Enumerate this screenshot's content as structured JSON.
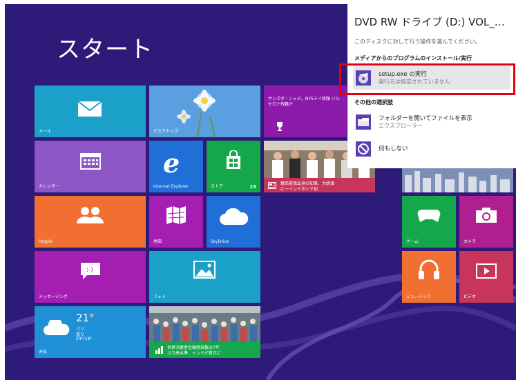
{
  "screen": {
    "title": "スタート"
  },
  "tiles": {
    "mail": "メール",
    "desktop": "デスクトップ",
    "news_headline": "サンズボ・シャピ。NY5テイ修顔 バルセロナ残籍か",
    "calendar": "カレンダー",
    "ie": "Internet Explorer",
    "store": "ストア",
    "store_badge": "15",
    "news2_line1": "爾西豪徳出身の知事、大統領",
    "news2_line2": "にーインドネシア初",
    "people": "People",
    "maps": "地図",
    "skydrive": "SkyDrive",
    "games": "ゲーム",
    "camera": "カメラ",
    "messaging": "メッセージング",
    "photos": "フォト",
    "music": "ミュージック",
    "video": "ビデオ",
    "weather_temp": "21°",
    "weather_city": "パリ",
    "weather_cond": "曇り",
    "weather_range": "24°/18°",
    "weather": "天気",
    "finance_line1": "世界消費者信頼感指数は7年",
    "finance_line2": "ぶり高水準、インドが首位に"
  },
  "popup": {
    "title": "DVD RW ドライブ (D:) VOL_…",
    "subtitle": "このディスクに対して行う操作を選んでください。",
    "section_install": "メディアからのプログラムのインストール/実行",
    "option_setup_title": "setup.exe の実行",
    "option_setup_sub": "発行元は指定されていません",
    "section_other": "その他の選択肢",
    "option_folder_title": "フォルダーを開いてファイルを表示",
    "option_folder_sub": "エクスプローラー",
    "option_none_title": "何もしない"
  },
  "colors": {
    "background": "#2e1a78",
    "highlight": "#e00012"
  }
}
